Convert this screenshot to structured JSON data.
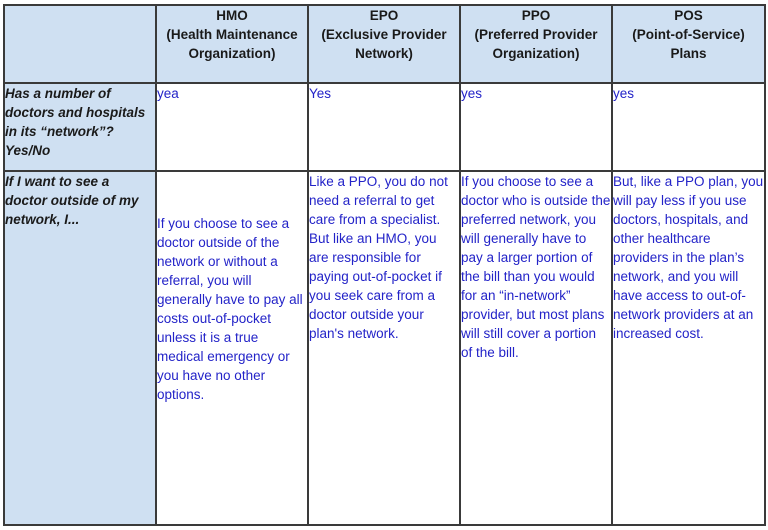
{
  "table": {
    "columns": [
      {
        "key": "corner",
        "lines": []
      },
      {
        "key": "hmo",
        "lines": [
          "HMO",
          "(Health Maintenance",
          "Organization)"
        ]
      },
      {
        "key": "epo",
        "lines": [
          "EPO",
          "(Exclusive Provider",
          "Network)"
        ]
      },
      {
        "key": "ppo",
        "lines": [
          "PPO",
          "(Preferred Provider",
          "Organization)"
        ]
      },
      {
        "key": "pos",
        "lines": [
          "POS",
          "(Point-of-Service)",
          "Plans"
        ]
      }
    ],
    "rows": [
      {
        "label": "Has a number of doctors and hospitals in its “network”? Yes/No",
        "values": {
          "hmo": "yea",
          "epo": "Yes",
          "ppo": "yes",
          "pos": "yes"
        }
      },
      {
        "label": "If I want to see a doctor outside of my network, I...",
        "values": {
          "hmo": " If you choose to see a doctor outside of the network or without a referral, you will generally have to pay all costs out-of-pocket unless it is a true medical emergency or you have no other options.",
          "epo": "Like a PPO, you do not need a referral to get care from a specialist. But like an HMO, you are responsible for paying out-of-pocket if you seek care from a doctor outside your plan's network.",
          "ppo": "If you choose to see a doctor who is outside the preferred network, you will generally have to pay a larger portion of the bill than you would for an “in-network” provider, but most plans will still cover a portion of the bill.",
          "pos": "But, like a PPO plan, you will pay less if you use doctors, hospitals, and other healthcare providers in the plan’s network, and you will have access to out-of-network providers at an increased cost."
        }
      }
    ]
  },
  "colors": {
    "header_bg": "#cfe0f2",
    "value_text": "#2323c8",
    "label_text": "#1a1a1a",
    "border": "#3a3a3a"
  }
}
